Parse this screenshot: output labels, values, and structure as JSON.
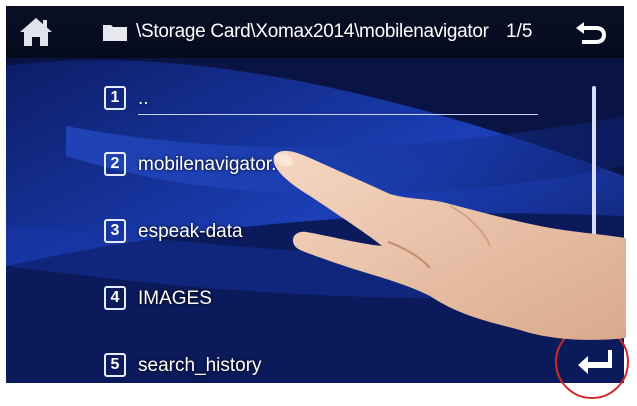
{
  "header": {
    "home_icon": "home-icon",
    "folder_icon": "folder-icon",
    "path": "\\Storage Card\\Xomax2014\\mobilenavigator",
    "page_indicator": "1/5",
    "back_icon": "back-arrow-icon"
  },
  "files": [
    {
      "index": "1",
      "name": ".."
    },
    {
      "index": "2",
      "name": "mobilenavigator.exe"
    },
    {
      "index": "3",
      "name": "espeak-data"
    },
    {
      "index": "4",
      "name": "IMAGES"
    },
    {
      "index": "5",
      "name": "search_history"
    }
  ],
  "controls": {
    "enter_icon": "enter-return-icon"
  },
  "colors": {
    "screen_bg": "#08123a",
    "accent_blue": "#1d3fc0",
    "text": "#ffffff",
    "highlight_circle": "#cc2a2a"
  }
}
